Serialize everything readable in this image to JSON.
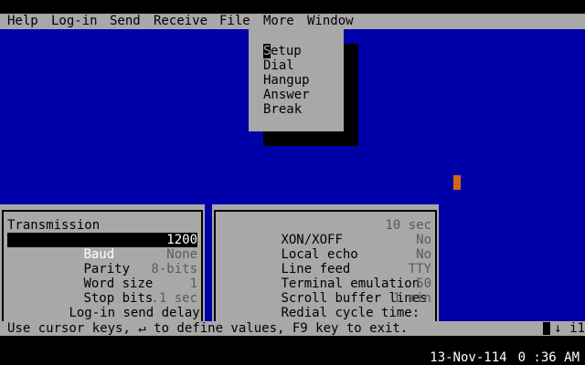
{
  "menubar": {
    "items": [
      "Help",
      "Log-in",
      "Send",
      "Receive",
      "File",
      "More",
      "Window"
    ]
  },
  "dropdown": {
    "items": [
      "Setup",
      "Dial",
      "Hangup",
      "Answer",
      "Break"
    ]
  },
  "left_panel": {
    "title": "Transmission",
    "rows": [
      {
        "label": "Baud",
        "value": "1200"
      },
      {
        "label": "Parity",
        "value": "None"
      },
      {
        "label": "Word size",
        "value": "8-bits"
      },
      {
        "label": "Stop bits",
        "value": "1"
      },
      {
        "label": "Log-in send delay",
        "value": ".1 sec"
      }
    ]
  },
  "right_panel": {
    "rows": [
      {
        "label": "XON/XOFF",
        "value": "10 sec"
      },
      {
        "label": "Local echo",
        "value": "No"
      },
      {
        "label": "Line feed",
        "value": "No"
      },
      {
        "label": "Terminal emulation",
        "value": "TTY"
      },
      {
        "label": "Scroll buffer lines",
        "value": "50"
      },
      {
        "label": "Redial cycle time:",
        "value": "1 min"
      }
    ]
  },
  "status": {
    "text": "Use cursor keys, ↵ to define values, F9 key to exit.",
    "right": "↓ i1"
  },
  "clock": {
    "date": "13-Nov-114",
    "time": "0 :36 AM"
  },
  "colors": {
    "blue": "#0000a8",
    "gray": "#a8a8a8",
    "cursor": "#d06a10"
  }
}
